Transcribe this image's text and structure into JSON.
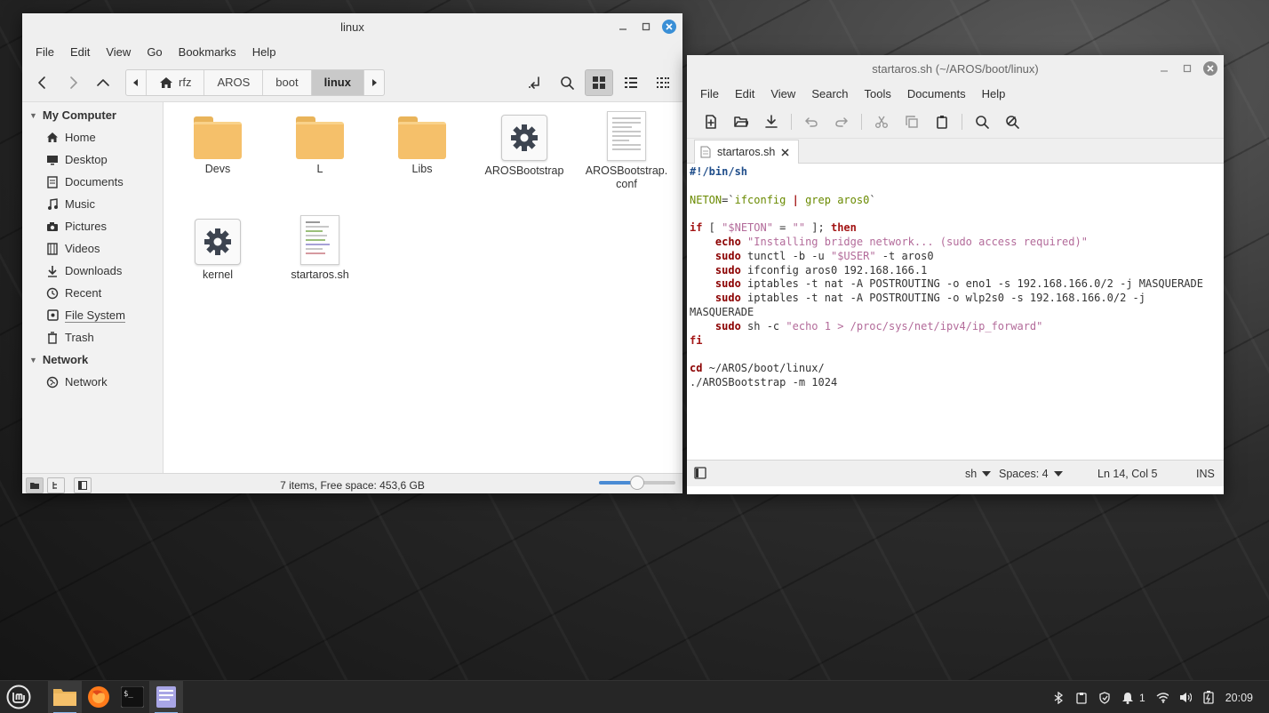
{
  "file_manager": {
    "title": "linux",
    "menu": [
      "File",
      "Edit",
      "View",
      "Go",
      "Bookmarks",
      "Help"
    ],
    "breadcrumb": [
      "rfz",
      "AROS",
      "boot",
      "linux"
    ],
    "sidebar": {
      "my_computer": {
        "heading": "My Computer",
        "items": [
          {
            "label": "Home",
            "icon": "home-icon"
          },
          {
            "label": "Desktop",
            "icon": "desktop-icon"
          },
          {
            "label": "Documents",
            "icon": "documents-icon"
          },
          {
            "label": "Music",
            "icon": "music-icon"
          },
          {
            "label": "Pictures",
            "icon": "camera-icon"
          },
          {
            "label": "Videos",
            "icon": "film-icon"
          },
          {
            "label": "Downloads",
            "icon": "download-icon"
          },
          {
            "label": "Recent",
            "icon": "clock-icon"
          },
          {
            "label": "File System",
            "icon": "drive-icon"
          },
          {
            "label": "Trash",
            "icon": "trash-icon"
          }
        ]
      },
      "network": {
        "heading": "Network",
        "items": [
          {
            "label": "Network",
            "icon": "network-icon"
          }
        ]
      }
    },
    "files": [
      {
        "name": "Devs",
        "type": "folder"
      },
      {
        "name": "L",
        "type": "folder"
      },
      {
        "name": "Libs",
        "type": "folder"
      },
      {
        "name": "AROSBootstrap",
        "type": "executable"
      },
      {
        "name": "AROSBootstrap.\nconf",
        "type": "document"
      },
      {
        "name": "kernel",
        "type": "executable"
      },
      {
        "name": "startaros.sh",
        "type": "script"
      }
    ],
    "status": "7 items, Free space: 453,6 GB",
    "zoom_level": 0.5
  },
  "editor": {
    "title": "startaros.sh (~/AROS/boot/linux)",
    "menu": [
      "File",
      "Edit",
      "View",
      "Search",
      "Tools",
      "Documents",
      "Help"
    ],
    "tab_label": "startaros.sh",
    "status": {
      "language": "sh",
      "spaces": "Spaces: 4",
      "position": "Ln 14, Col 5",
      "mode": "INS"
    }
  },
  "taskbar": {
    "clock": "20:09",
    "notification_count": "1"
  },
  "colors": {
    "accent": "#3a8fd6",
    "close_button": "#3a8fd6",
    "folder": "#f5c06a",
    "taskbar": "#262626"
  }
}
